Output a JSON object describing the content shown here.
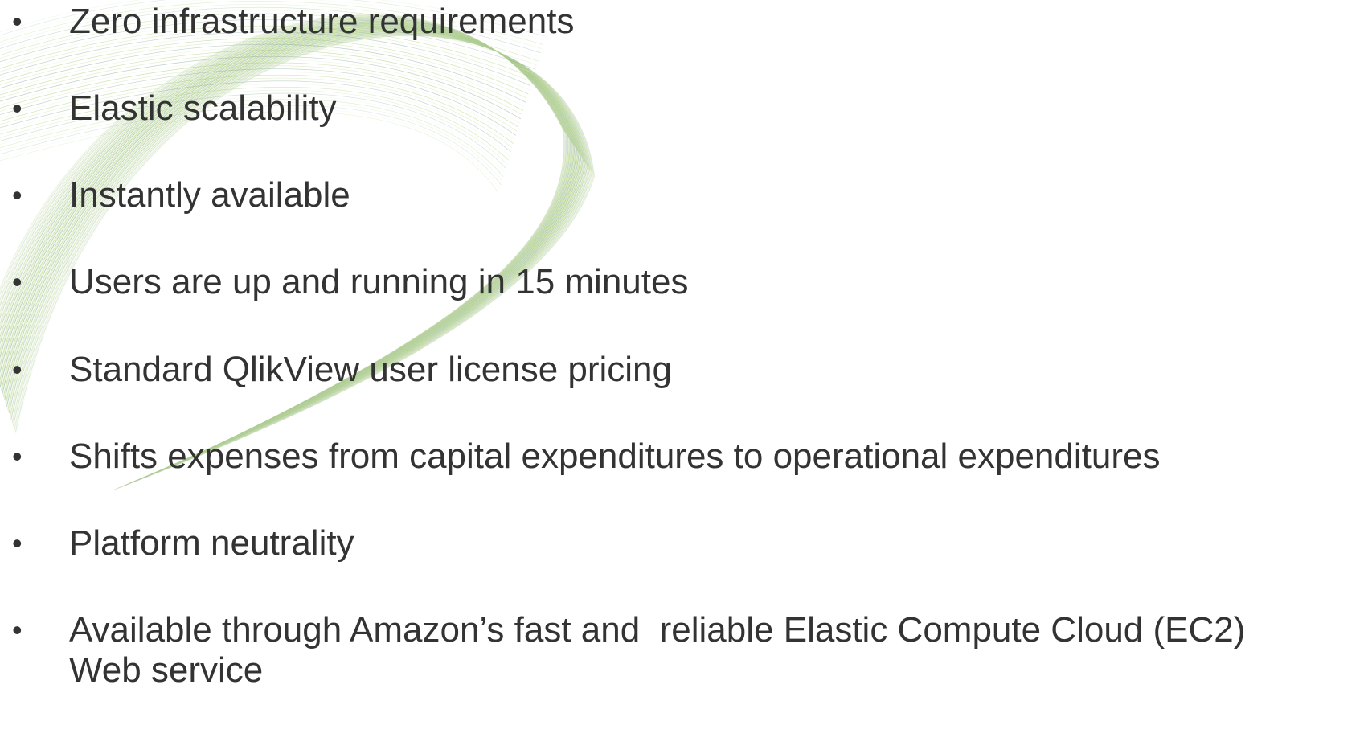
{
  "slide": {
    "bullet_glyph": "•",
    "background_color": "#ffffff",
    "text_color": "#333333",
    "accent_colors": [
      "#9cc95c",
      "#c6dfa0",
      "#7fa38e",
      "#e2efcf"
    ],
    "decoration": "green-swirl-line-art",
    "items": [
      {
        "text": "Zero infrastructure requirements"
      },
      {
        "text": "Elastic scalability"
      },
      {
        "text": "Instantly available"
      },
      {
        "text": "Users are up and running in 15 minutes"
      },
      {
        "text": "Standard QlikView user license pricing"
      },
      {
        "text": "Shifts expenses from capital expenditures to operational expenditures"
      },
      {
        "text": "Platform neutrality"
      },
      {
        "text": "Available through Amazon’s fast and  reliable Elastic Compute Cloud (EC2)\nWeb service"
      }
    ]
  }
}
